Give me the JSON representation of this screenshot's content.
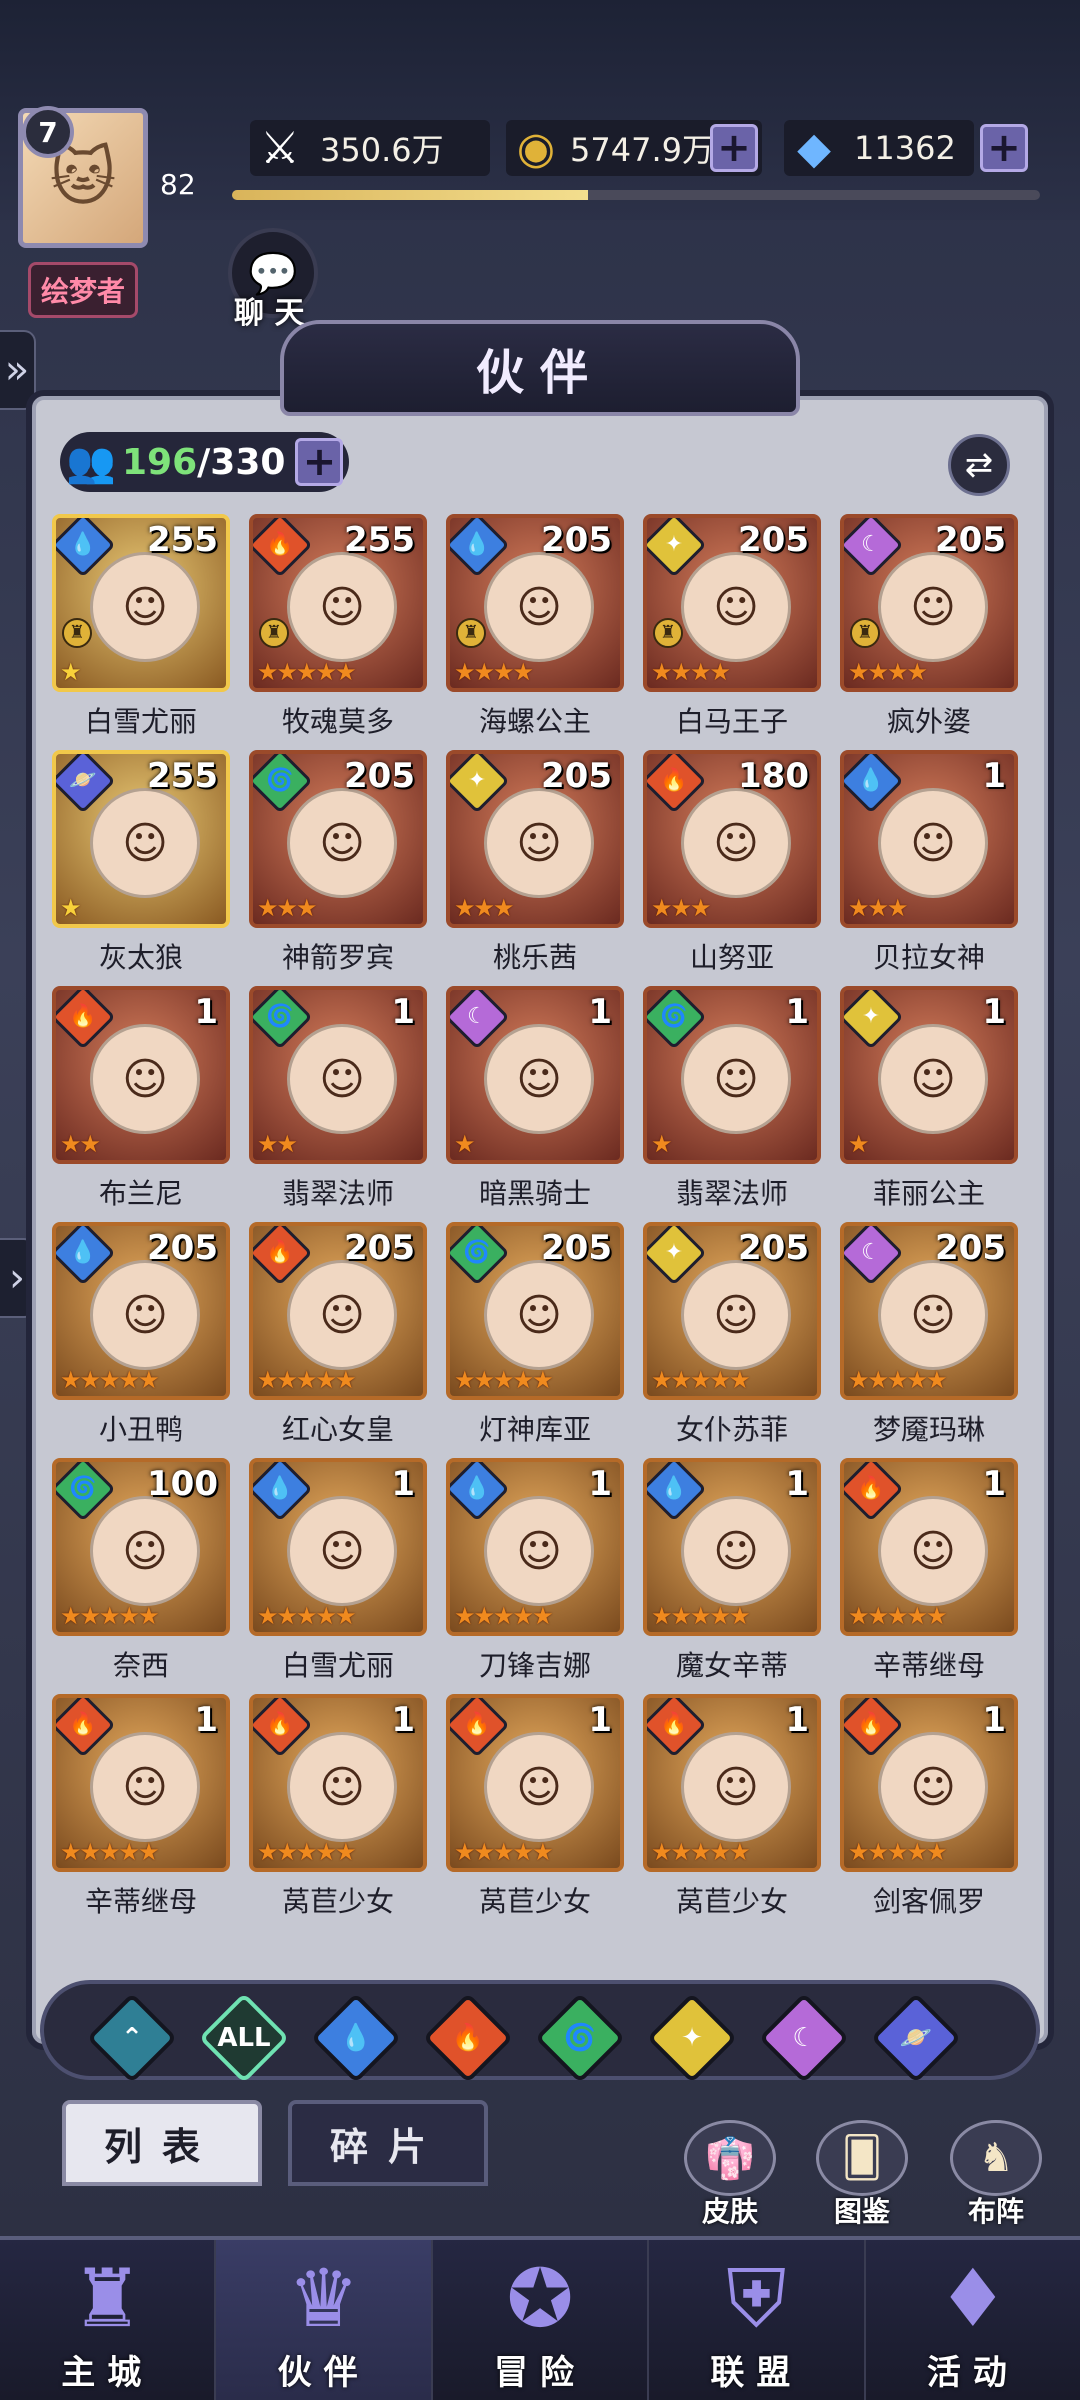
{
  "hud": {
    "player_level": "7",
    "vip_value": "82",
    "title_tag": "绘梦者",
    "exp_fraction": 0.44,
    "power": "350.6万",
    "gold": "5747.9万",
    "gems": "11362",
    "plus": "+"
  },
  "chat": {
    "label": "聊 天"
  },
  "panel": {
    "title": "伙伴",
    "count_current": "196",
    "count_max": "/330"
  },
  "cards": [
    {
      "name": "白雪尤丽",
      "level": "255",
      "element": "water",
      "stars": "★",
      "star_style": "gold",
      "frame": "gold",
      "rank": true
    },
    {
      "name": "牧魂莫多",
      "level": "255",
      "element": "fire",
      "stars": "★★★★★",
      "star_style": "orange",
      "frame": "red",
      "rank": true
    },
    {
      "name": "海螺公主",
      "level": "205",
      "element": "water",
      "stars": "★★★★",
      "star_style": "orange",
      "frame": "red",
      "rank": true
    },
    {
      "name": "白马王子",
      "level": "205",
      "element": "light",
      "stars": "★★★★",
      "star_style": "orange",
      "frame": "red",
      "rank": true
    },
    {
      "name": "疯外婆",
      "level": "205",
      "element": "moon",
      "stars": "★★★★",
      "star_style": "orange",
      "frame": "red",
      "rank": true
    },
    {
      "name": "灰太狼",
      "level": "255",
      "element": "planet",
      "stars": "★",
      "star_style": "gold",
      "frame": "gold",
      "rank": false
    },
    {
      "name": "神箭罗宾",
      "level": "205",
      "element": "wind",
      "stars": "★★★",
      "star_style": "orange",
      "frame": "red",
      "rank": false
    },
    {
      "name": "桃乐茜",
      "level": "205",
      "element": "light",
      "stars": "★★★",
      "star_style": "orange",
      "frame": "red",
      "rank": false
    },
    {
      "name": "山努亚",
      "level": "180",
      "element": "fire",
      "stars": "★★★",
      "star_style": "orange",
      "frame": "red",
      "rank": false
    },
    {
      "name": "贝拉女神",
      "level": "1",
      "element": "water",
      "stars": "★★★",
      "star_style": "orange",
      "frame": "red",
      "rank": false
    },
    {
      "name": "布兰尼",
      "level": "1",
      "element": "fire",
      "stars": "★★",
      "star_style": "orange",
      "frame": "red",
      "rank": false
    },
    {
      "name": "翡翠法师",
      "level": "1",
      "element": "wind",
      "stars": "★★",
      "star_style": "orange",
      "frame": "red",
      "rank": false
    },
    {
      "name": "暗黑骑士",
      "level": "1",
      "element": "moon",
      "stars": "★",
      "star_style": "orange",
      "frame": "red",
      "rank": false
    },
    {
      "name": "翡翠法师",
      "level": "1",
      "element": "wind",
      "stars": "★",
      "star_style": "orange",
      "frame": "red",
      "rank": false
    },
    {
      "name": "菲丽公主",
      "level": "1",
      "element": "light",
      "stars": "★",
      "star_style": "orange",
      "frame": "red",
      "rank": false
    },
    {
      "name": "小丑鸭",
      "level": "205",
      "element": "water",
      "stars": "★★★★★",
      "star_style": "orange",
      "frame": "orange",
      "rank": false
    },
    {
      "name": "红心女皇",
      "level": "205",
      "element": "fire",
      "stars": "★★★★★",
      "star_style": "orange",
      "frame": "orange",
      "rank": false
    },
    {
      "name": "灯神库亚",
      "level": "205",
      "element": "wind",
      "stars": "★★★★★",
      "star_style": "orange",
      "frame": "orange",
      "rank": false
    },
    {
      "name": "女仆苏菲",
      "level": "205",
      "element": "light",
      "stars": "★★★★★",
      "star_style": "orange",
      "frame": "orange",
      "rank": false
    },
    {
      "name": "梦魇玛琳",
      "level": "205",
      "element": "moon",
      "stars": "★★★★★",
      "star_style": "orange",
      "frame": "orange",
      "rank": false
    },
    {
      "name": "奈西",
      "level": "100",
      "element": "wind",
      "stars": "★★★★★",
      "star_style": "orange",
      "frame": "orange",
      "rank": false
    },
    {
      "name": "白雪尤丽",
      "level": "1",
      "element": "water",
      "stars": "★★★★★",
      "star_style": "orange",
      "frame": "orange",
      "rank": false
    },
    {
      "name": "刀锋吉娜",
      "level": "1",
      "element": "water",
      "stars": "★★★★★",
      "star_style": "orange",
      "frame": "orange",
      "rank": false
    },
    {
      "name": "魔女辛蒂",
      "level": "1",
      "element": "water",
      "stars": "★★★★★",
      "star_style": "orange",
      "frame": "orange",
      "rank": false
    },
    {
      "name": "辛蒂继母",
      "level": "1",
      "element": "fire",
      "stars": "★★★★★",
      "star_style": "orange",
      "frame": "orange",
      "rank": false
    },
    {
      "name": "辛蒂继母",
      "level": "1",
      "element": "fire",
      "stars": "★★★★★",
      "star_style": "orange",
      "frame": "orange",
      "rank": false
    },
    {
      "name": "莴苣少女",
      "level": "1",
      "element": "fire",
      "stars": "★★★★★",
      "star_style": "orange",
      "frame": "orange",
      "rank": false
    },
    {
      "name": "莴苣少女",
      "level": "1",
      "element": "fire",
      "stars": "★★★★★",
      "star_style": "orange",
      "frame": "orange",
      "rank": false
    },
    {
      "name": "莴苣少女",
      "level": "1",
      "element": "fire",
      "stars": "★★★★★",
      "star_style": "orange",
      "frame": "orange",
      "rank": false
    },
    {
      "name": "剑客佩罗",
      "level": "1",
      "element": "fire",
      "stars": "★★★★★",
      "star_style": "orange",
      "frame": "orange",
      "rank": false
    }
  ],
  "filters": [
    {
      "id": "wind-up",
      "label": "⌃",
      "color": "#2f7f95"
    },
    {
      "id": "all",
      "label": "ALL",
      "color": "#1f3a32"
    },
    {
      "id": "water",
      "label": "💧",
      "color": "#3d7fe0"
    },
    {
      "id": "fire",
      "label": "🔥",
      "color": "#e0522a"
    },
    {
      "id": "wind",
      "label": "🌀",
      "color": "#3ab060"
    },
    {
      "id": "light",
      "label": "✦",
      "color": "#e0c23a"
    },
    {
      "id": "moon",
      "label": "☾",
      "color": "#b56ad8"
    },
    {
      "id": "planet",
      "label": "🪐",
      "color": "#5a62d8"
    }
  ],
  "tabs": {
    "list": "列表",
    "shards": "碎片"
  },
  "quick": {
    "skin": "皮肤",
    "codex": "图鉴",
    "formation": "布阵"
  },
  "nav": [
    {
      "label": "主城",
      "icon": "♜"
    },
    {
      "label": "伙伴",
      "icon": "♛"
    },
    {
      "label": "冒险",
      "icon": "✪"
    },
    {
      "label": "联盟",
      "icon": "⛨"
    },
    {
      "label": "活动",
      "icon": "♦"
    }
  ],
  "element_colors": {
    "water": "#3d7fe0",
    "fire": "#e0522a",
    "light": "#e0c23a",
    "moon": "#b56ad8",
    "planet": "#5a62d8",
    "wind": "#3ab060"
  },
  "element_icons": {
    "water": "💧",
    "fire": "🔥",
    "light": "✦",
    "moon": "☾",
    "planet": "🪐",
    "wind": "🌀"
  }
}
